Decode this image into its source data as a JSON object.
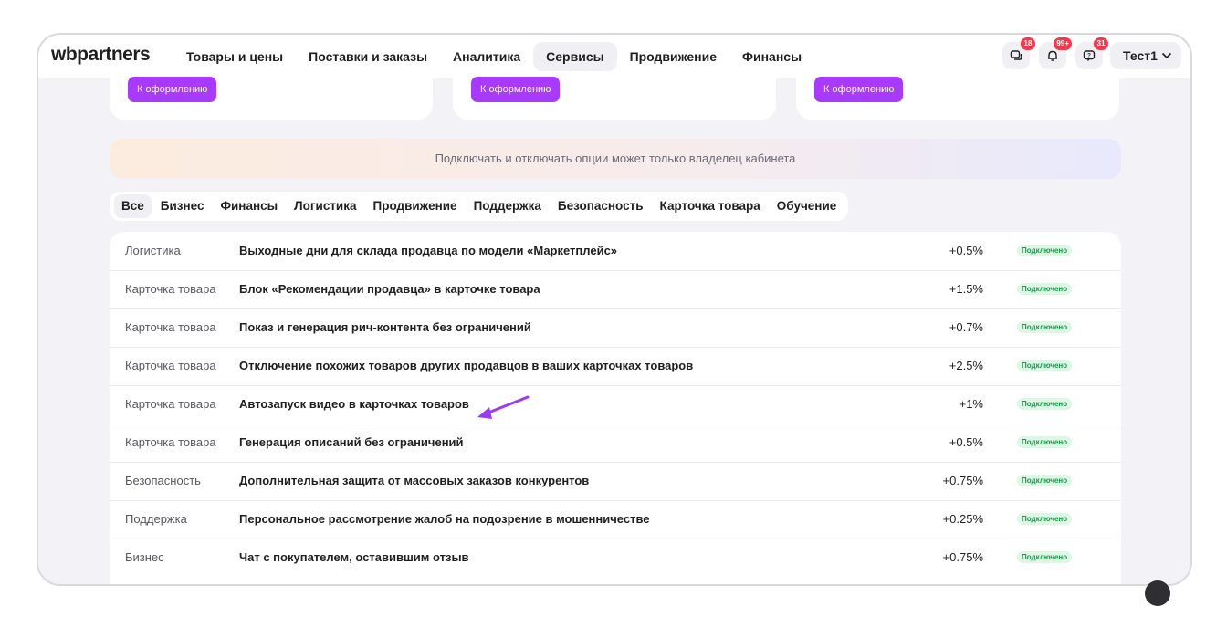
{
  "header": {
    "logo": "wbpartners",
    "nav": [
      {
        "label": "Товары и цены"
      },
      {
        "label": "Поставки и заказы"
      },
      {
        "label": "Аналитика"
      },
      {
        "label": "Сервисы"
      },
      {
        "label": "Продвижение"
      },
      {
        "label": "Финансы"
      }
    ],
    "active_nav": "Сервисы",
    "badges": {
      "chat": "18",
      "notifications": "99+",
      "support": "31"
    },
    "icons": [
      "chat-icon",
      "bell-icon",
      "support-icon",
      "chevron-down-icon"
    ],
    "user": "Тест1"
  },
  "cards": [
    {
      "button": "К оформлению"
    },
    {
      "button": "К оформлению"
    },
    {
      "button": "К оформлению"
    }
  ],
  "notice": "Подключать и отключать опции может только владелец кабинета",
  "tabs": [
    {
      "label": "Все"
    },
    {
      "label": "Бизнес"
    },
    {
      "label": "Финансы"
    },
    {
      "label": "Логистика"
    },
    {
      "label": "Продвижение"
    },
    {
      "label": "Поддержка"
    },
    {
      "label": "Безопасность"
    },
    {
      "label": "Карточка товара"
    },
    {
      "label": "Обучение"
    }
  ],
  "active_tab": "Все",
  "rows": [
    {
      "category": "Логистика",
      "name": "Выходные дни для склада продавца по модели «Маркетплейс»",
      "percent": "+0.5%",
      "status": "Подключено"
    },
    {
      "category": "Карточка товара",
      "name": "Блок «Рекомендации продавца» в карточке товара",
      "percent": "+1.5%",
      "status": "Подключено"
    },
    {
      "category": "Карточка товара",
      "name": "Показ и генерация рич-контента без ограничений",
      "percent": "+0.7%",
      "status": "Подключено"
    },
    {
      "category": "Карточка товара",
      "name": "Отключение похожих товаров других продавцов в ваших карточках товаров",
      "percent": "+2.5%",
      "status": "Подключено"
    },
    {
      "category": "Карточка товара",
      "name": "Автозапуск видео в карточках товаров",
      "percent": "+1%",
      "status": "Подключено"
    },
    {
      "category": "Карточка товара",
      "name": "Генерация описаний без ограничений",
      "percent": "+0.5%",
      "status": "Подключено"
    },
    {
      "category": "Безопасность",
      "name": "Дополнительная защита от массовых заказов конкурентов",
      "percent": "+0.75%",
      "status": "Подключено"
    },
    {
      "category": "Поддержка",
      "name": "Персональное рассмотрение жалоб на подозрение в мошенничестве",
      "percent": "+0.25%",
      "status": "Подключено"
    },
    {
      "category": "Бизнес",
      "name": "Чат с покупателем, оставившим отзыв",
      "percent": "+0.75%",
      "status": "Подключено"
    }
  ],
  "colors": {
    "accent": "#a73afd",
    "badge": "#f5384b",
    "status_bg": "#dff5e6",
    "status_text": "#1c9a4b"
  }
}
